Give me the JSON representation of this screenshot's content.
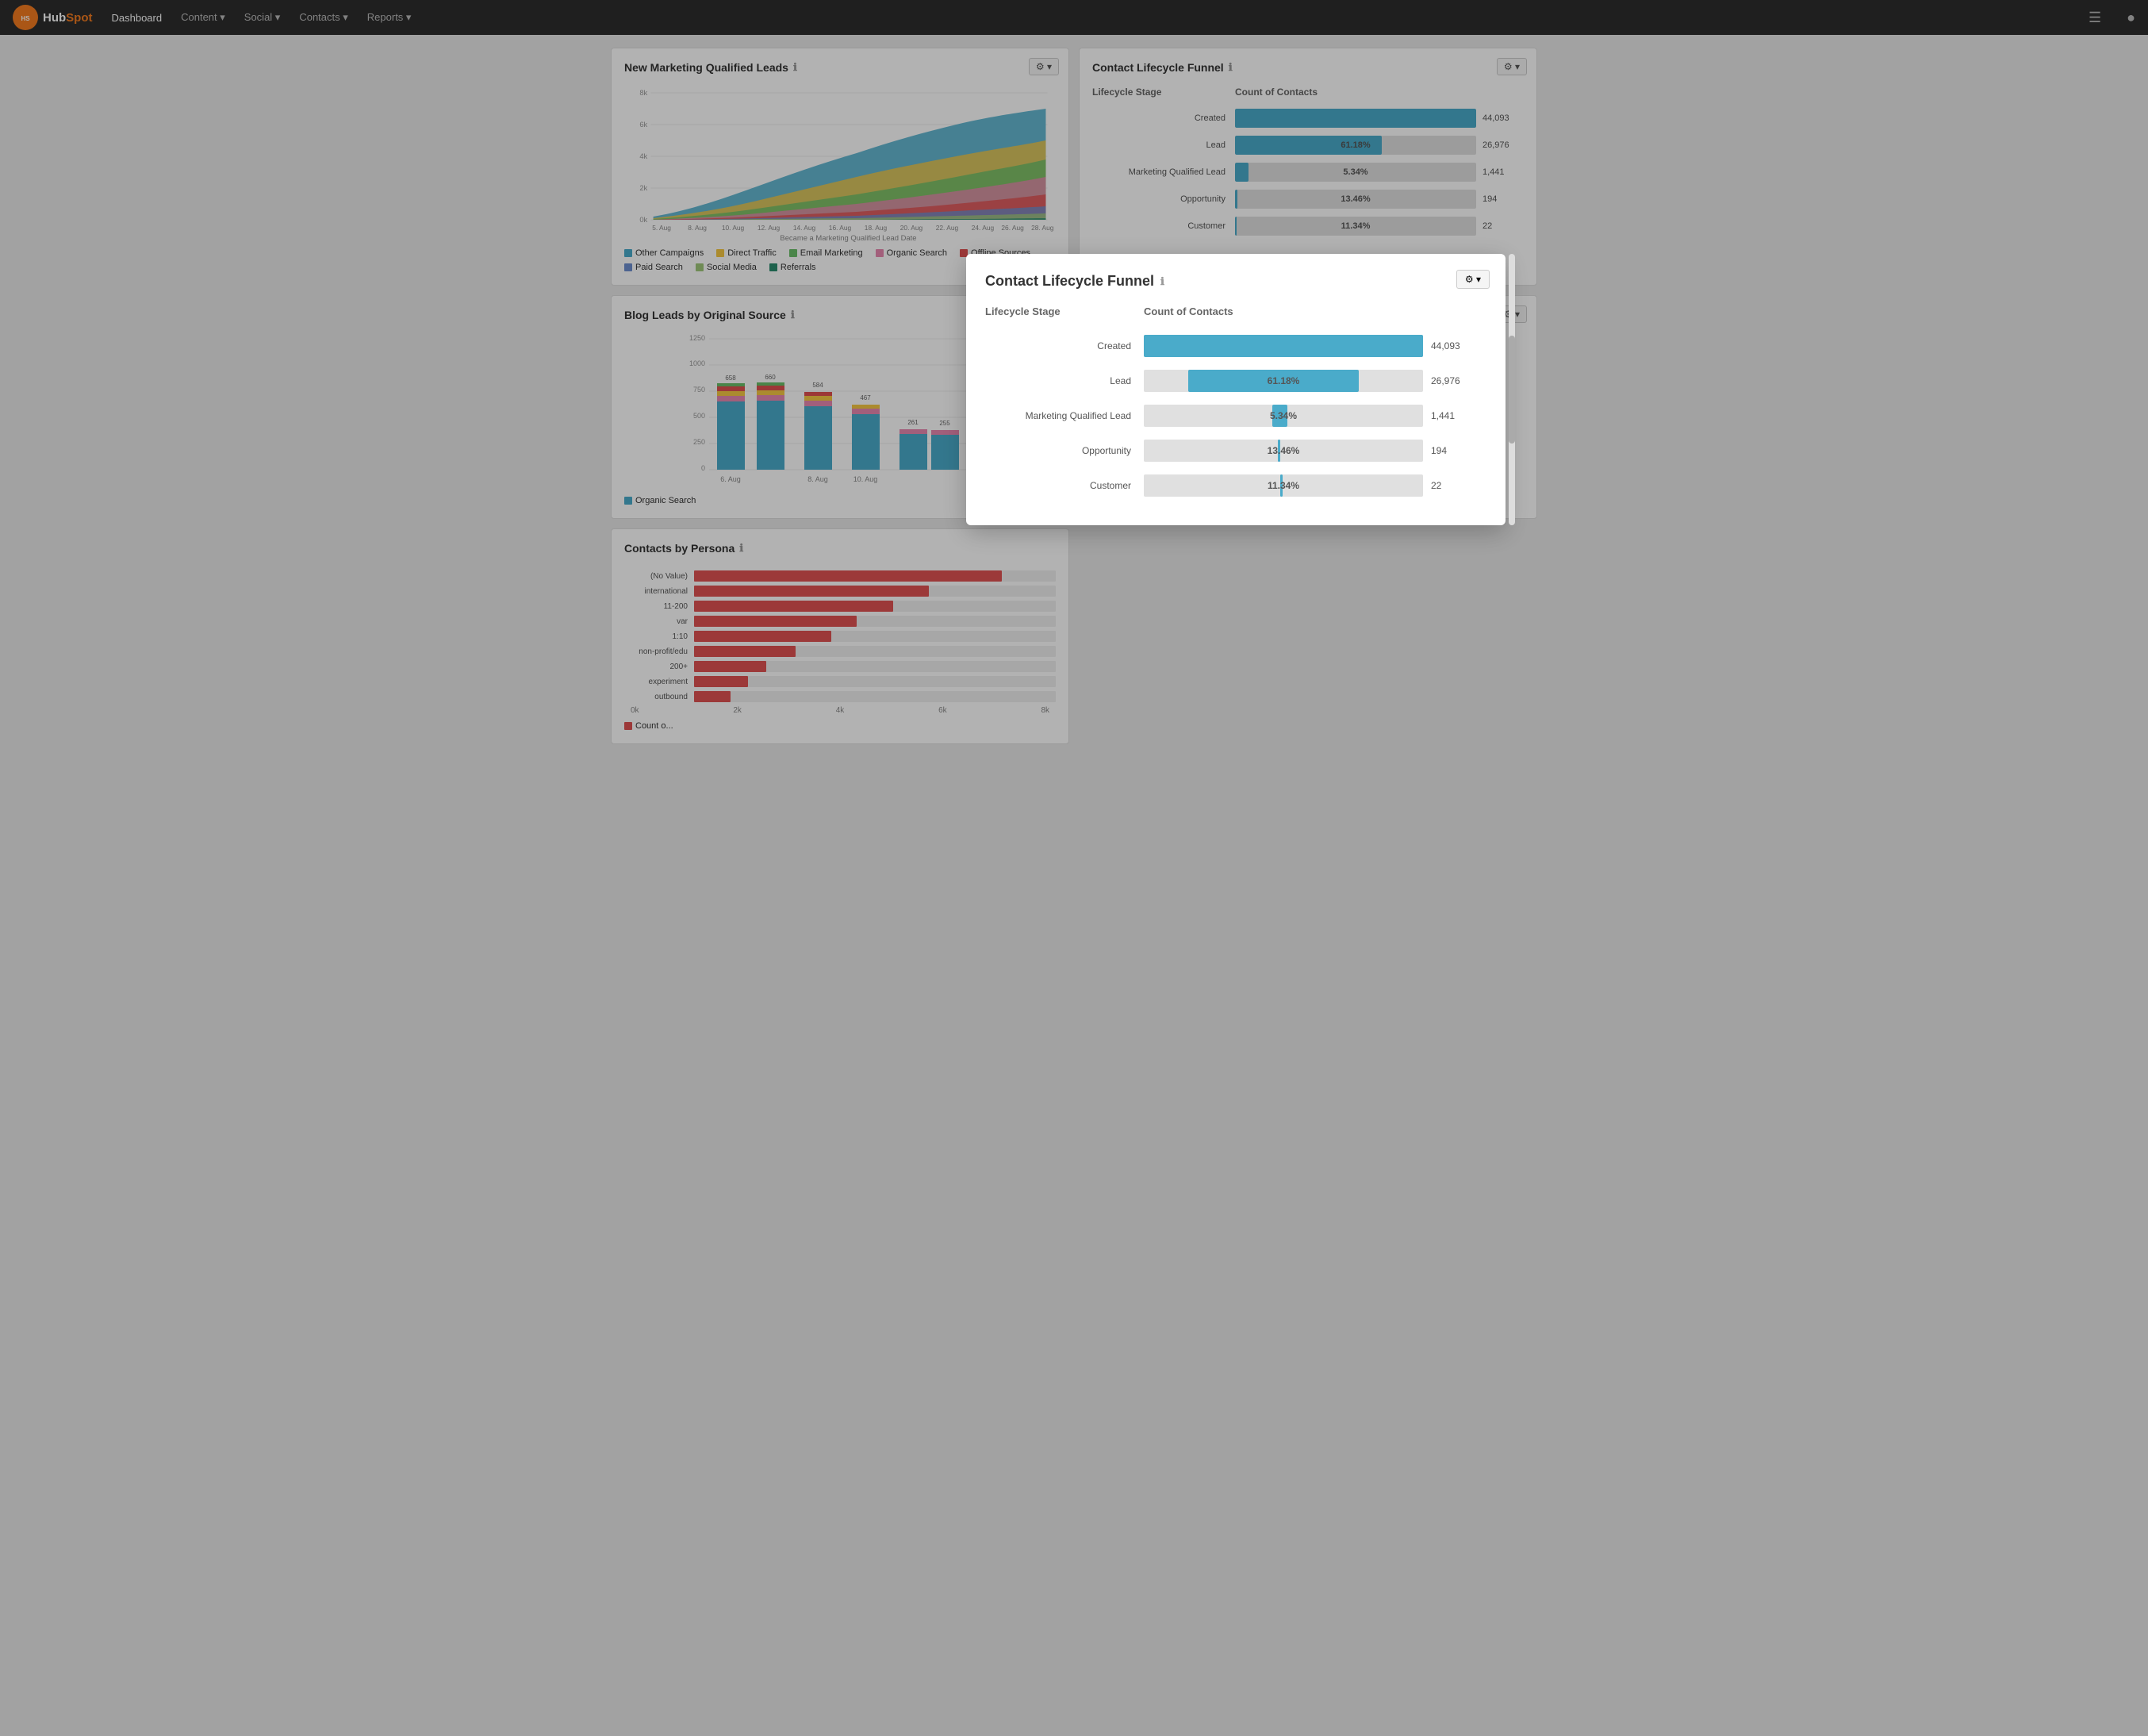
{
  "navbar": {
    "brand": "HubSpot",
    "items": [
      {
        "label": "Dashboard",
        "active": true
      },
      {
        "label": "Content",
        "hasDropdown": true
      },
      {
        "label": "Social",
        "hasDropdown": true
      },
      {
        "label": "Contacts",
        "hasDropdown": true
      },
      {
        "label": "Reports",
        "hasDropdown": true
      }
    ]
  },
  "mqLeads": {
    "title": "New Marketing Qualified Leads",
    "subtitle": "Became a Marketing Qualified Lead Date",
    "legend": [
      {
        "label": "Other Campaigns",
        "color": "#4aabca"
      },
      {
        "label": "Direct Traffic",
        "color": "#f5c842"
      },
      {
        "label": "Email Marketing",
        "color": "#6abf69"
      },
      {
        "label": "Organic Search",
        "color": "#e888b0"
      },
      {
        "label": "Offline Sources",
        "color": "#e05050"
      },
      {
        "label": "Paid Search",
        "color": "#6e8fce"
      },
      {
        "label": "Social Media",
        "color": "#a0c87a"
      },
      {
        "label": "Referrals",
        "color": "#2a8c6e"
      }
    ],
    "yLabels": [
      "8k",
      "6k",
      "4k",
      "2k",
      "0k"
    ],
    "xLabels": [
      "5. Aug",
      "8. Aug",
      "10. Aug",
      "12. Aug",
      "14. Aug",
      "16. Aug",
      "18. Aug",
      "20. Aug",
      "22. Aug",
      "24. Aug",
      "26. Aug",
      "28. Aug"
    ]
  },
  "funnelSmall": {
    "title": "Contact Lifecycle Funnel",
    "headers": [
      "Lifecycle Stage",
      "Count of Contacts",
      ""
    ],
    "rows": [
      {
        "label": "Created",
        "pct": 100,
        "count": "44,093",
        "percentLabel": "",
        "barWidth": 100
      },
      {
        "label": "Lead",
        "pct": 61.18,
        "count": "26,976",
        "percentLabel": "61.18%",
        "barWidth": 61
      },
      {
        "label": "Marketing Qualified Lead",
        "pct": 5.34,
        "count": "1,441",
        "percentLabel": "5.34%",
        "barWidth": 5.5
      },
      {
        "label": "Opportunity",
        "pct": 13.46,
        "count": "194",
        "percentLabel": "13.46%",
        "barWidth": 1
      },
      {
        "label": "Customer",
        "pct": 11.34,
        "count": "22",
        "percentLabel": "11.34%",
        "barWidth": 0.8
      }
    ]
  },
  "blogLeads": {
    "title": "Blog Leads by Original Source",
    "yLabels": [
      "1250",
      "1000",
      "750",
      "500",
      "250",
      "0"
    ],
    "bars": [
      {
        "label": "6. Aug",
        "value": 658,
        "height": 53
      },
      {
        "label": "",
        "value": 660,
        "height": 53
      },
      {
        "label": "8. Aug",
        "value": 584,
        "height": 47
      },
      {
        "label": "",
        "value": 0,
        "height": 0
      },
      {
        "label": "10. Aug",
        "value": 467,
        "height": 37
      },
      {
        "label": "",
        "value": 0,
        "height": 0
      },
      {
        "label": "",
        "value": 261,
        "height": 21
      },
      {
        "label": "",
        "value": 255,
        "height": 20
      }
    ],
    "legend": [
      {
        "label": "Organic Search",
        "color": "#4aabca"
      }
    ]
  },
  "contacts": {
    "title": "Contacts by Persona",
    "personas": [
      {
        "label": "(No Value)",
        "width": 85
      },
      {
        "label": "international",
        "width": 65
      },
      {
        "label": "11-200",
        "width": 55
      },
      {
        "label": "var",
        "width": 45
      },
      {
        "label": "1:10",
        "width": 38
      },
      {
        "label": "non-profit/edu",
        "width": 28
      },
      {
        "label": "200+",
        "width": 20
      },
      {
        "label": "experiment",
        "width": 15
      },
      {
        "label": "outbound",
        "width": 10
      }
    ],
    "xLabels": [
      "0k",
      "2k",
      "4k",
      "6k",
      "8k"
    ],
    "legend": "Count o..."
  },
  "modal": {
    "title": "Contact Lifecycle Funnel",
    "headers": [
      "Lifecycle Stage",
      "Count of Contacts",
      ""
    ],
    "rows": [
      {
        "label": "Created",
        "percentLabel": "",
        "count": "44,093",
        "barWidth": 100,
        "showPercent": false
      },
      {
        "label": "Lead",
        "percentLabel": "61.18%",
        "count": "26,976",
        "barWidth": 61,
        "showPercent": true
      },
      {
        "label": "Marketing Qualified Lead",
        "percentLabel": "5.34%",
        "count": "1,441",
        "barWidth": 5.5,
        "showPercent": true
      },
      {
        "label": "Opportunity",
        "percentLabel": "13.46%",
        "count": "194",
        "barWidth": 1,
        "showPercent": true
      },
      {
        "label": "Customer",
        "percentLabel": "11.34%",
        "count": "22",
        "barWidth": 0.8,
        "showPercent": true
      }
    ]
  },
  "colors": {
    "primary": "#4aabca",
    "accent": "#f47c20",
    "danger": "#e05252",
    "nav_bg": "#2d2d2d"
  }
}
